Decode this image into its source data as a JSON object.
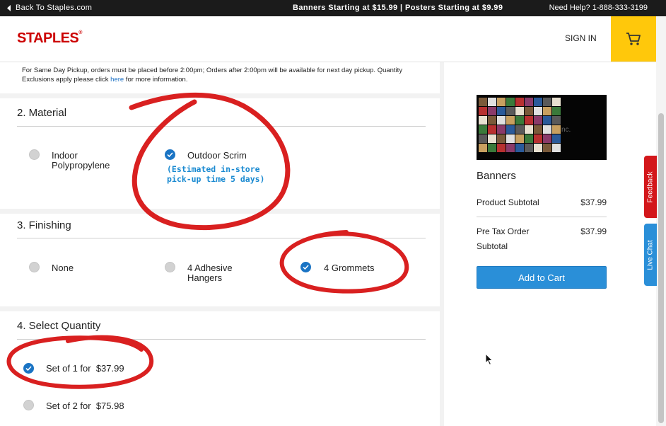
{
  "topbar": {
    "back_link": "Back To Staples.com",
    "promo": "Banners Starting at $15.99 | Posters Starting at $9.99",
    "help": "Need Help? 1-888-333-3199"
  },
  "header": {
    "logo": "STAPLES",
    "signin": "SIGN IN",
    "cart_icon": "cart-icon",
    "accent": "#ffc80b",
    "brand": "#cc0000"
  },
  "notice": {
    "text_before": "For Same Day Pickup, orders must be placed before 2:00pm; Orders after 2:00pm will be available for next day pickup. Quantity Exclusions apply please click ",
    "link": "here",
    "text_after": " for more information."
  },
  "sections": {
    "material": {
      "title": "2. Material",
      "options": [
        {
          "label": "Indoor Polypropylene",
          "selected": false
        },
        {
          "label": "Outdoor Scrim",
          "selected": true,
          "note": "(Estimated in-store pick-up time 5 days)"
        }
      ]
    },
    "finishing": {
      "title": "3. Finishing",
      "options": [
        {
          "label": "None",
          "selected": false
        },
        {
          "label": "4 Adhesive Hangers",
          "selected": false
        },
        {
          "label": "4 Grommets",
          "selected": true
        }
      ]
    },
    "quantity": {
      "title": "4. Select Quantity",
      "options": [
        {
          "label": "Set of 1 for  $37.99",
          "selected": true
        },
        {
          "label": "Set of 2 for  $75.98",
          "selected": false
        }
      ]
    }
  },
  "summary": {
    "product_name": "Banners",
    "rows": [
      {
        "label": "Product Subtotal",
        "value": "$37.99"
      },
      {
        "label": "Pre Tax Order Subtotal",
        "value": "$37.99"
      }
    ],
    "add_to_cart": "Add to Cart",
    "button_color": "#2a8fd8"
  },
  "side_tabs": {
    "feedback": "Feedback",
    "live_chat": "Live Chat"
  },
  "annotation_color": "#d92020"
}
